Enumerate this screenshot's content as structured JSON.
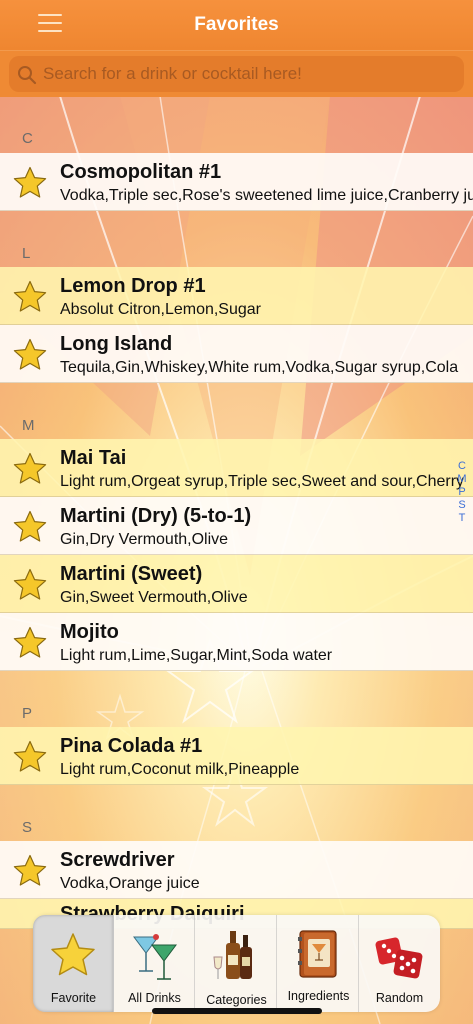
{
  "navbar": {
    "title": "Favorites"
  },
  "search": {
    "placeholder": "Search for a drink or cocktail here!"
  },
  "sections": [
    {
      "letter": "C"
    },
    {
      "letter": "L"
    },
    {
      "letter": "M"
    },
    {
      "letter": "P"
    },
    {
      "letter": "S"
    }
  ],
  "drinks": [
    {
      "name": "Cosmopolitan #1",
      "ingredients": "Vodka,Triple sec,Rose's sweetened lime juice,Cranberry juice"
    },
    {
      "name": "Lemon Drop #1",
      "ingredients": "Absolut Citron,Lemon,Sugar"
    },
    {
      "name": "Long Island",
      "ingredients": "Tequila,Gin,Whiskey,White rum,Vodka,Sugar syrup,Cola"
    },
    {
      "name": "Mai Tai",
      "ingredients": "Light rum,Orgeat syrup,Triple sec,Sweet and sour,Cherry"
    },
    {
      "name": "Martini (Dry) (5-to-1)",
      "ingredients": "Gin,Dry Vermouth,Olive"
    },
    {
      "name": "Martini (Sweet)",
      "ingredients": "Gin,Sweet Vermouth,Olive"
    },
    {
      "name": "Mojito",
      "ingredients": "Light rum,Lime,Sugar,Mint,Soda water"
    },
    {
      "name": "Pina Colada #1",
      "ingredients": "Light rum,Coconut milk,Pineapple"
    },
    {
      "name": "Screwdriver",
      "ingredients": "Vodka,Orange juice"
    },
    {
      "name": "Strawberry Daiquiri",
      "ingredients": ""
    }
  ],
  "index_letters": [
    "C",
    "M",
    "P",
    "S",
    "T"
  ],
  "tabs": [
    {
      "label": "Favorite",
      "icon": "star-icon"
    },
    {
      "label": "All Drinks",
      "icon": "cocktail-glasses-icon"
    },
    {
      "label": "Categories",
      "icon": "bottles-icon"
    },
    {
      "label": "Ingredients",
      "icon": "recipe-book-icon"
    },
    {
      "label": "Random",
      "icon": "dice-icon"
    }
  ],
  "colors": {
    "accent": "#ef8630",
    "index": "#3d6fd6",
    "star": "#f5c72a"
  }
}
